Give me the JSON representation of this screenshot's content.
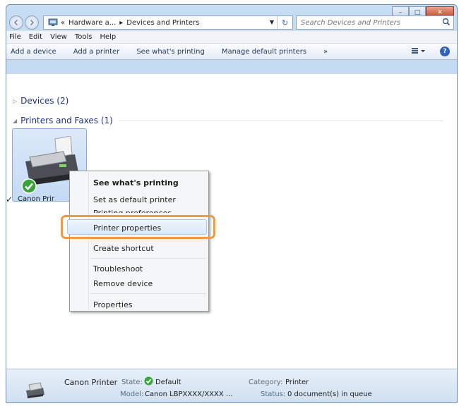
{
  "window": {
    "caption_buttons": {
      "minimize": "–",
      "maximize": "□",
      "close": "✕"
    },
    "address": {
      "segments": [
        "«",
        "Hardware a...",
        "▸",
        "Devices and Printers"
      ],
      "refresh_glyph": "↻"
    },
    "search": {
      "placeholder": "Search Devices and Printers"
    }
  },
  "menubar": {
    "items": [
      "File",
      "Edit",
      "View",
      "Tools",
      "Help"
    ]
  },
  "toolbar": {
    "add_device": "Add a device",
    "add_printer": "Add a printer",
    "see_printing": "See what's printing",
    "manage_default": "Manage default printers",
    "more": "»",
    "help": "?"
  },
  "groups": {
    "devices": {
      "label": "Devices (2)",
      "expanded": false
    },
    "printers": {
      "label": "Printers and Faxes (1)",
      "expanded": true
    }
  },
  "device": {
    "label": "Canon Prir"
  },
  "context_menu": {
    "items": [
      {
        "label": "See what's printing",
        "bold": true
      },
      {
        "label": "Set as default printer",
        "checked": true
      },
      {
        "label": "Printing preferences",
        "cut": true
      },
      {
        "label": "Printer properties",
        "highlighted": true
      },
      {
        "label": "Create shortcut"
      },
      {
        "label": "Troubleshoot"
      },
      {
        "label": "Remove device"
      },
      {
        "label": "Properties"
      }
    ],
    "check_glyph": "✓"
  },
  "details": {
    "name": "Canon Printer",
    "state_key": "State:",
    "state_value": "Default",
    "model_key": "Model:",
    "model_value": "Canon LBPXXXX/XXXX ...",
    "category_key": "Category:",
    "category_value": "Printer",
    "status_key": "Status:",
    "status_value": "0 document(s) in queue"
  },
  "colors": {
    "highlight_ring": "#f29a3d",
    "group_header": "#1e3287",
    "accent": "#2e63b8"
  }
}
